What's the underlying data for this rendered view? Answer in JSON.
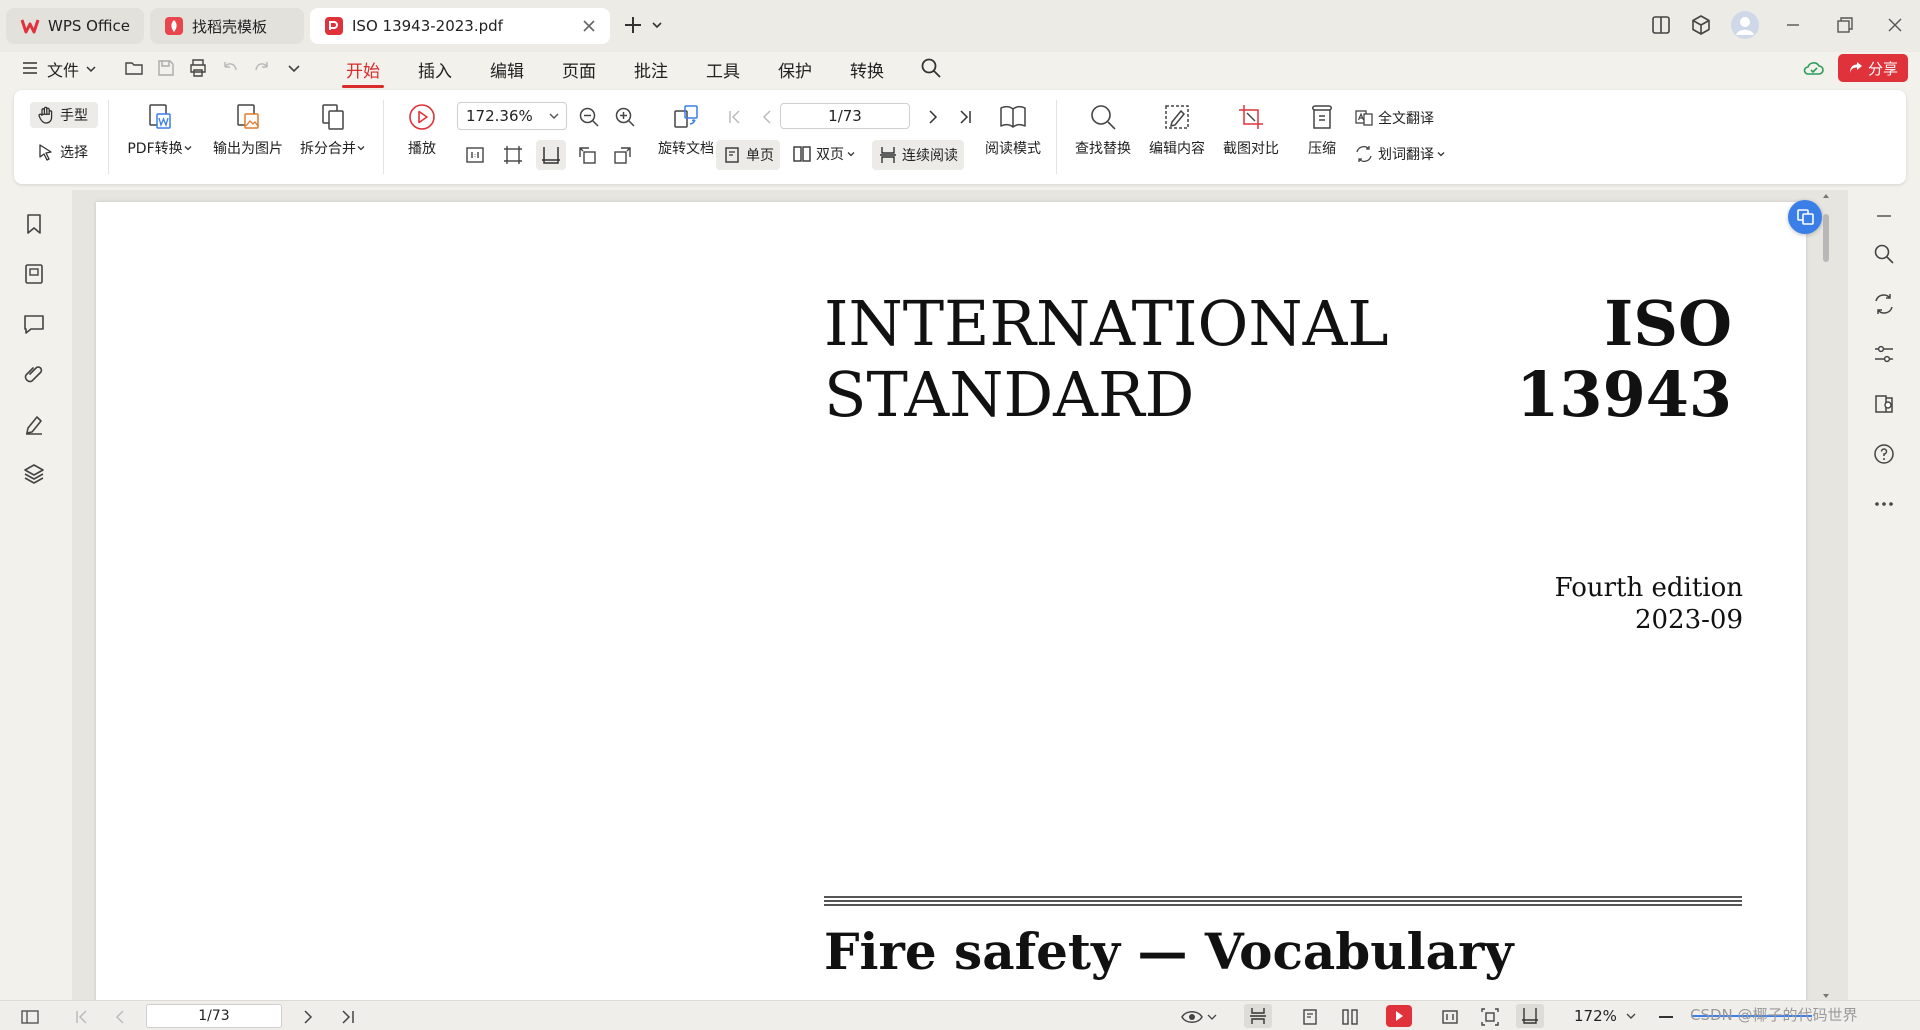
{
  "tabs": {
    "wps": "WPS Office",
    "template": "找稻壳模板",
    "pdf": "ISO 13943-2023.pdf"
  },
  "menu": {
    "file": "文件",
    "items": [
      "开始",
      "插入",
      "编辑",
      "页面",
      "批注",
      "工具",
      "保护",
      "转换"
    ],
    "share": "分享"
  },
  "ribbon": {
    "hand": "手型",
    "select": "选择",
    "pdf_convert": "PDF转换",
    "export_image": "输出为图片",
    "split_merge": "拆分合并",
    "play": "播放",
    "zoom_value": "172.36%",
    "page_value": "1/73",
    "rotate_doc": "旋转文档",
    "single_page": "单页",
    "double_page": "双页",
    "continuous": "连续阅读",
    "read_mode": "阅读模式",
    "find_replace": "查找替换",
    "edit_content": "编辑内容",
    "screenshot_compare": "截图对比",
    "compress": "压缩",
    "full_translate": "全文翻译",
    "word_translate": "划词翻译"
  },
  "document": {
    "line1_left": "INTERNATIONAL",
    "line2_left": "STANDARD",
    "line1_right": "ISO",
    "line2_right": "13943",
    "edition": "Fourth edition",
    "date": "2023-09",
    "title": "Fire safety — Vocabulary"
  },
  "status": {
    "page_value": "1/73",
    "zoom": "172%",
    "watermark": "CSDN @椰子的代码世界"
  },
  "colors": {
    "accent": "#d92b2b",
    "share_bg": "#e0323b",
    "fab": "#3a7ee8"
  }
}
